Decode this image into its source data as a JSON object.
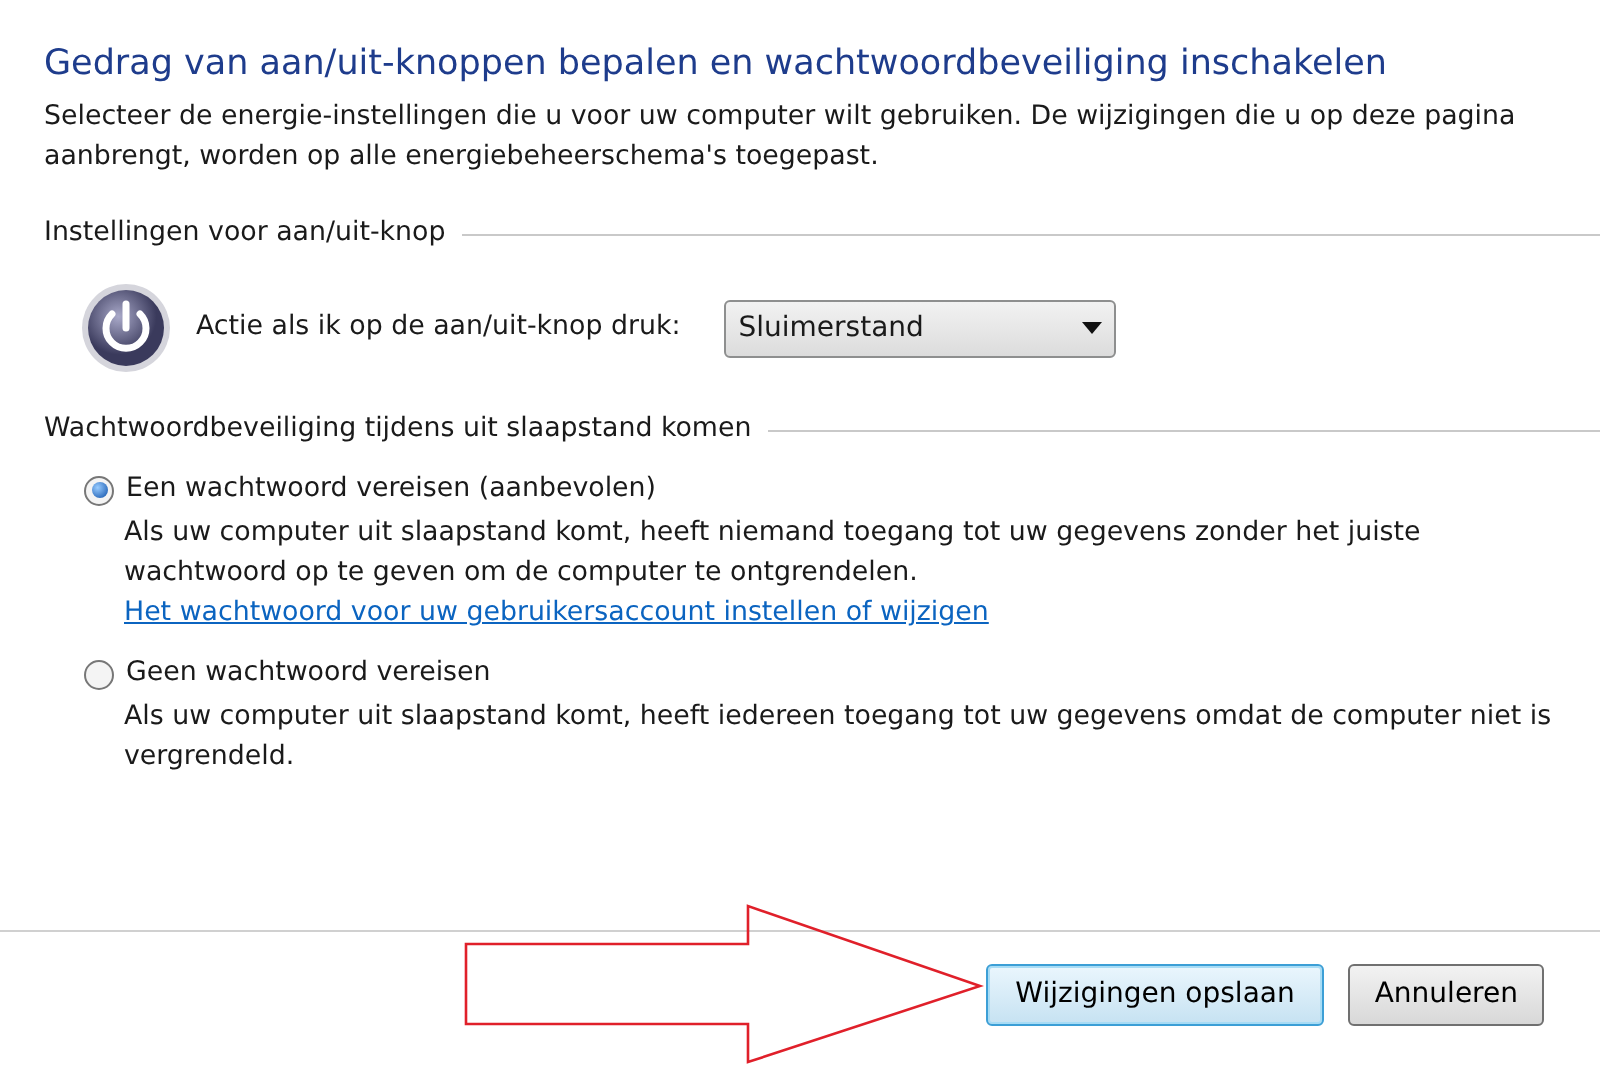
{
  "title": "Gedrag van aan/uit-knoppen bepalen en wachtwoordbeveiliging inschakelen",
  "intro": "Selecteer de energie-instellingen die u voor uw computer wilt gebruiken. De wijzigingen die u op deze pagina aanbrengt, worden op alle energiebeheerschema's toegepast.",
  "power_section": {
    "heading": "Instellingen voor aan/uit-knop",
    "label": "Actie als ik op de aan/uit-knop druk:",
    "dropdown": {
      "value": "Sluimerstand"
    }
  },
  "password_section": {
    "heading": "Wachtwoordbeveiliging tijdens uit slaapstand komen",
    "options": [
      {
        "label": "Een wachtwoord vereisen (aanbevolen)",
        "selected": true,
        "description": "Als uw computer uit slaapstand komt, heeft niemand toegang tot uw gegevens zonder het juiste wachtwoord op te geven om de computer te ontgrendelen.",
        "link": "Het wachtwoord voor uw gebruikersaccount instellen of wijzigen"
      },
      {
        "label": "Geen wachtwoord vereisen",
        "selected": false,
        "description": "Als uw computer uit slaapstand komt, heeft iedereen toegang tot uw gegevens omdat de computer niet is vergrendeld."
      }
    ]
  },
  "buttons": [
    {
      "label": "Wijzigingen opslaan",
      "default": true
    },
    {
      "label": "Annuleren",
      "default": false
    }
  ]
}
